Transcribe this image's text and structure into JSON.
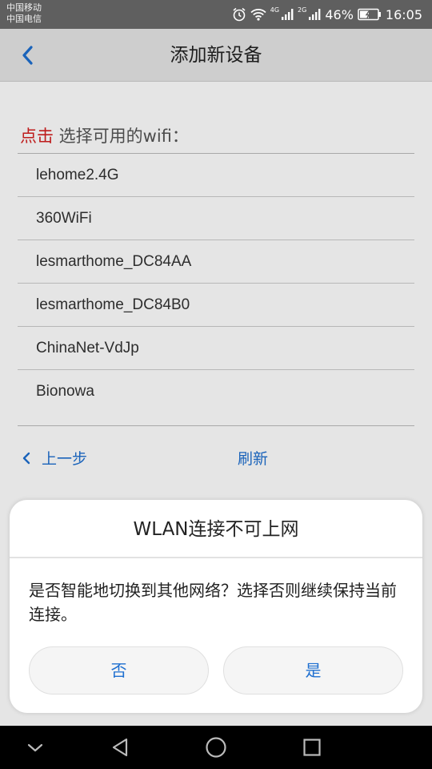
{
  "status_bar": {
    "carrier_1": "中国移动",
    "carrier_2": "中国电信",
    "network_tag_1": "4G",
    "network_tag_2": "2G",
    "battery": "46%",
    "time": "16:05"
  },
  "header": {
    "title": "添加新设备"
  },
  "wifi_section": {
    "prompt_highlight": "点击",
    "prompt_text": " 选择可用的wifi：",
    "networks": [
      "lehome2.4G",
      "360WiFi",
      "lesmarthome_DC84AA",
      "lesmarthome_DC84B0",
      "ChinaNet-VdJp",
      "Bionowa"
    ]
  },
  "actions": {
    "prev_label": "上一步",
    "refresh_label": "刷新"
  },
  "dialog": {
    "title": "WLAN连接不可上网",
    "message": "是否智能地切换到其他网络？选择否则继续保持当前连接。",
    "no_label": "否",
    "yes_label": "是"
  },
  "colors": {
    "accent": "#1e6fd0",
    "highlight_red": "#d42020"
  }
}
